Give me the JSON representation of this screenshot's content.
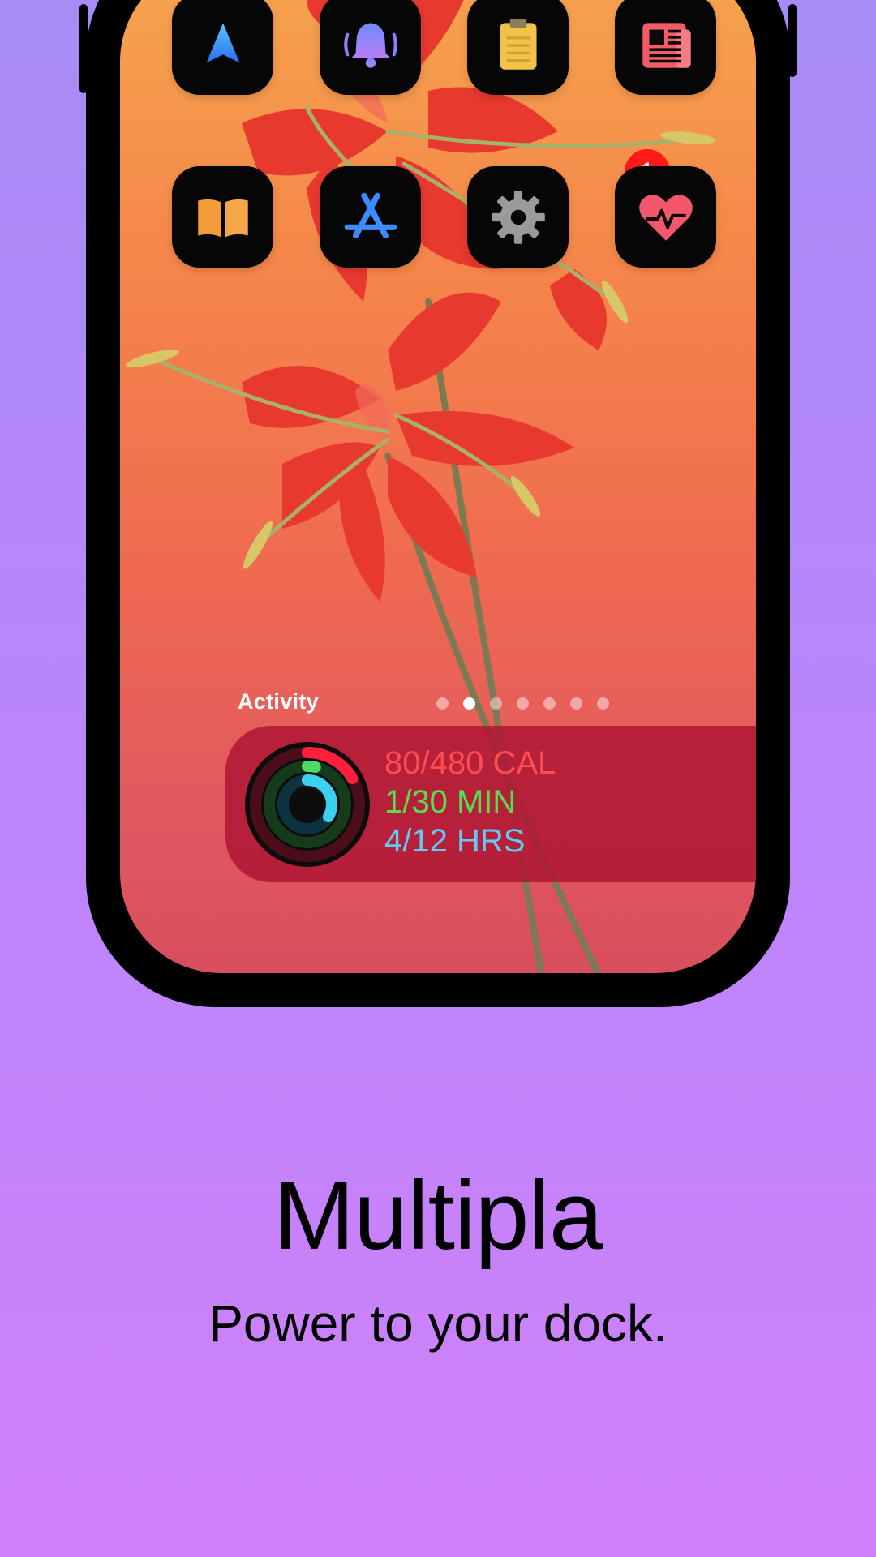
{
  "apps": [
    {
      "icon": "navigation-arrow-icon",
      "label": ""
    },
    {
      "icon": "bell-icon",
      "label": ""
    },
    {
      "icon": "clipboard-icon",
      "label": ""
    },
    {
      "icon": "news-icon",
      "label": ""
    },
    {
      "icon": "book-icon",
      "label": ""
    },
    {
      "icon": "app-store-icon",
      "label": ""
    },
    {
      "icon": "gear-icon",
      "label": "",
      "badge": "1"
    },
    {
      "icon": "heart-rate-icon",
      "label": ""
    }
  ],
  "widget": {
    "label": "Activity",
    "page_count": 7,
    "active_page": 2,
    "calories": "80/480 CAL",
    "minutes": "1/30 MIN",
    "hours": "4/12 HRS",
    "move_progress": 0.1667,
    "exercise_progress": 0.0333,
    "stand_progress": 0.3333
  },
  "promo": {
    "title": "Multipla",
    "tagline": "Power to your dock."
  },
  "colors": {
    "move": "#ff1f3d",
    "exercise": "#4cd964",
    "stand": "#3ad0ee",
    "badge": "#ff1a1a"
  }
}
